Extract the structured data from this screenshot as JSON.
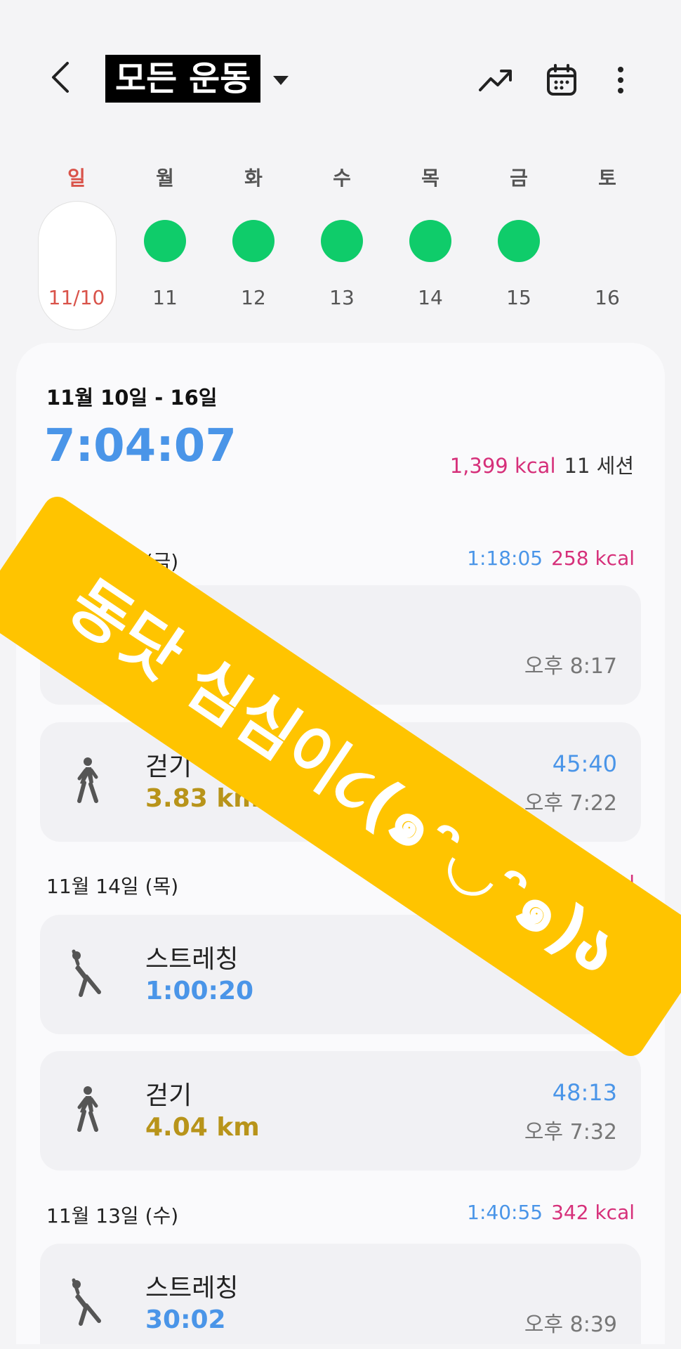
{
  "header": {
    "title": "모든 운동"
  },
  "week": [
    {
      "name": "일",
      "num": "11/10",
      "done": false,
      "selected": true
    },
    {
      "name": "월",
      "num": "11",
      "done": true,
      "selected": false
    },
    {
      "name": "화",
      "num": "12",
      "done": true,
      "selected": false
    },
    {
      "name": "수",
      "num": "13",
      "done": true,
      "selected": false
    },
    {
      "name": "목",
      "num": "14",
      "done": true,
      "selected": false
    },
    {
      "name": "금",
      "num": "15",
      "done": true,
      "selected": false
    },
    {
      "name": "토",
      "num": "16",
      "done": false,
      "selected": false
    }
  ],
  "summary": {
    "range": "11월 10일 - 16일",
    "total_time": "7:04:07",
    "kcal": "1,399 kcal",
    "sessions": "11 세션"
  },
  "days": [
    {
      "label": "11월 15일 (금)",
      "duration": "1:18:05",
      "kcal": "258 kcal",
      "items": [
        {
          "name": "스트레칭",
          "value": "",
          "top": "",
          "time": "오후 8:17"
        },
        {
          "name": "걷기",
          "value": "3.83 km",
          "top": "45:40",
          "time": "오후 7:22"
        }
      ]
    },
    {
      "label": "11월 14일 (목)",
      "duration": "",
      "kcal": "9 kcal",
      "items": [
        {
          "name": "스트레칭",
          "value": "1:00:20",
          "top": "",
          "time": ""
        },
        {
          "name": "걷기",
          "value": "4.04 km",
          "top": "48:13",
          "time": "오후 7:32"
        }
      ]
    },
    {
      "label": "11월 13일 (수)",
      "duration": "1:40:55",
      "kcal": "342 kcal",
      "items": [
        {
          "name": "스트레칭",
          "value": "30:02",
          "top": "",
          "time": "오후 8:39"
        }
      ]
    }
  ],
  "overlay": {
    "text": "동닷 심심이૮(๑ᵔ◡ᵔ๑)ა"
  },
  "colors": {
    "accent_blue": "#4a95e8",
    "kcal_pink": "#d6307a",
    "done_green": "#0fcc6a",
    "distance_gold": "#b8941a",
    "sunday_red": "#d9534a",
    "banner_yellow": "#ffc400"
  }
}
